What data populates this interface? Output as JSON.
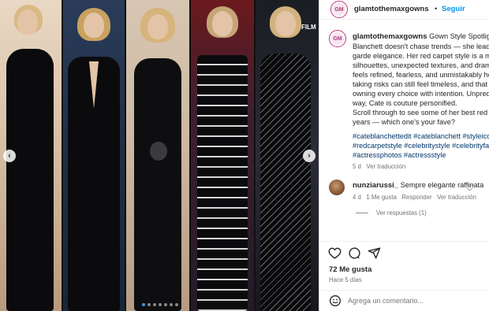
{
  "post": {
    "username": "glamtothemaxgowns",
    "avatar_text": "GM",
    "separator": "•",
    "follow_label": "Seguir",
    "comment_username": "glamtothemaxgowns",
    "caption_lines": [
      "Gown Style Spotlight: C",
      "Blanchett doesn't chase trends — she leads w",
      "garde elegance. Her red carpet style is a mas",
      "silhouettes, unexpected textures, and dramat",
      "feels refined, fearless, and unmistakably her.",
      "taking risks can still feel timeless, and that tru",
      "owning every choice with intention. Unpredic",
      "way, Cate is couture personified.",
      "Scroll through to see some of her best red ca",
      "years — which one's your fave?"
    ],
    "hashtag_lines": [
      "#cateblanchettedit #cateblanchett #styleicon",
      "#redcarpetstyle #celebritystyle #celebrityfash",
      "#actressphotos #actressstyle"
    ],
    "caption_age": "5 d",
    "see_translation": "Ver traducción"
  },
  "comment": {
    "username": "nunziarussi_",
    "text": "Sempre elegante raffinata",
    "age": "4 d",
    "likes": "1 Me gusta",
    "reply": "Responder",
    "translation": "Ver traducción",
    "view_replies": "Ver respuestas (1)"
  },
  "actions": {
    "likes_count": "72 Me gusta",
    "time_ago": "Hace 5 días"
  },
  "composer": {
    "placeholder": "Agrega un comentario..."
  },
  "carousel": {
    "prev_glyph": "‹",
    "next_glyph": "›",
    "dot_count": 7,
    "active_dot": 0,
    "backdrop_text": "FILM"
  },
  "colors": {
    "link_blue": "#0095f6",
    "hashtag_blue": "#00376b",
    "avatar_ring": "#c13584"
  },
  "icons": [
    "heart-icon",
    "comment-icon",
    "share-icon",
    "emoji-icon",
    "chevron-left-icon",
    "chevron-right-icon"
  ]
}
